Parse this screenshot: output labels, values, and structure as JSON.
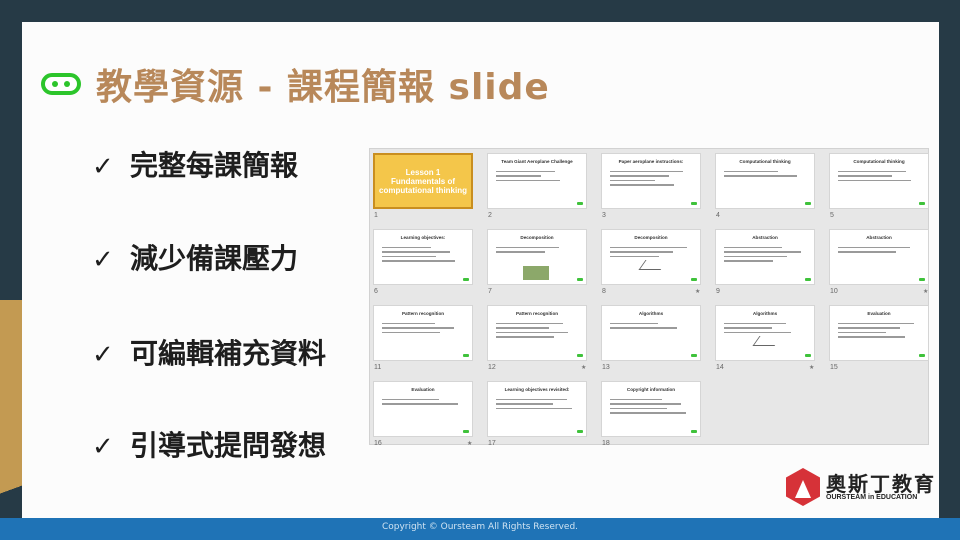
{
  "page": {
    "title": "教學資源 - 課程簡報 slide",
    "copyright": "Copyright © Oursteam All Rights Reserved."
  },
  "bullets": [
    {
      "check": "✓",
      "text": "完整每課簡報"
    },
    {
      "check": "✓",
      "text": "減少備課壓力"
    },
    {
      "check": "✓",
      "text": "可編輯補充資料"
    },
    {
      "check": "✓",
      "text": "引導式提問發想"
    }
  ],
  "thumbnails": [
    {
      "n": "1",
      "title": "Lesson 1 Fundamentals of computational thinking",
      "selected": true
    },
    {
      "n": "2",
      "title": "Team Giant Aeroplane Challenge"
    },
    {
      "n": "3",
      "title": "Paper aeroplane instructions:"
    },
    {
      "n": "4",
      "title": "Computational thinking"
    },
    {
      "n": "5",
      "title": "Computational thinking"
    },
    {
      "n": "6",
      "title": "Learning objectives:"
    },
    {
      "n": "7",
      "title": "Decomposition"
    },
    {
      "n": "8",
      "title": "Decomposition",
      "star": "★"
    },
    {
      "n": "9",
      "title": "Abstraction"
    },
    {
      "n": "10",
      "title": "Abstraction",
      "star": "★"
    },
    {
      "n": "11",
      "title": "Pattern recognition"
    },
    {
      "n": "12",
      "title": "Pattern recognition",
      "star": "★"
    },
    {
      "n": "13",
      "title": "Algorithms"
    },
    {
      "n": "14",
      "title": "Algorithms",
      "star": "★"
    },
    {
      "n": "15",
      "title": "Evaluation"
    },
    {
      "n": "16",
      "title": "Evaluation",
      "star": "★"
    },
    {
      "n": "17",
      "title": "Learning objectives revisited:"
    },
    {
      "n": "18",
      "title": "Copyright information"
    }
  ],
  "logo": {
    "zh": "奧斯丁教育",
    "en": "OURSTEAM in EDUCATION"
  },
  "colors": {
    "title": "#b8885a",
    "accent_green": "#2cc52b",
    "gold": "#c39a52",
    "dark": "#263a46",
    "blue": "#1f73b6"
  }
}
